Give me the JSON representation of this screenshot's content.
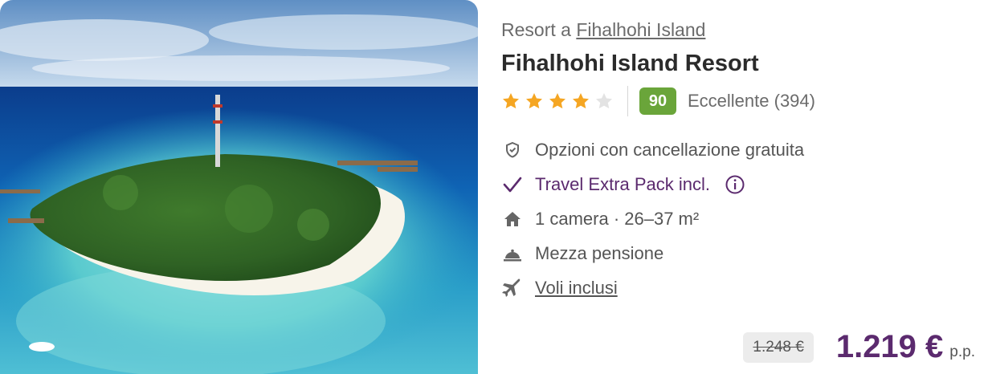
{
  "hotel": {
    "location_prefix": "Resort a",
    "location_link": "Fihalhohi Island",
    "name": "Fihalhohi Island Resort",
    "stars": 4,
    "max_stars": 5,
    "score": "90",
    "score_label": "Eccellente (394)"
  },
  "features": [
    {
      "icon": "shield-check-icon",
      "label": "Opzioni con cancellazione gratuita"
    },
    {
      "icon": "checkmark-icon",
      "label": "Travel Extra Pack incl."
    },
    {
      "icon": "house-icon",
      "label": "1 camera · 26–37 m²"
    },
    {
      "icon": "cloche-icon",
      "label": "Mezza pensione"
    },
    {
      "icon": "airplane-icon",
      "label": "Voli inclusi"
    }
  ],
  "price": {
    "old": "1.248 €",
    "new": "1.219 €",
    "unit": "p.p."
  },
  "colors": {
    "accent": "#5b2a6e",
    "score_badge": "#6aa53a",
    "star": "#f5a623",
    "star_empty": "#e3e3e3"
  }
}
